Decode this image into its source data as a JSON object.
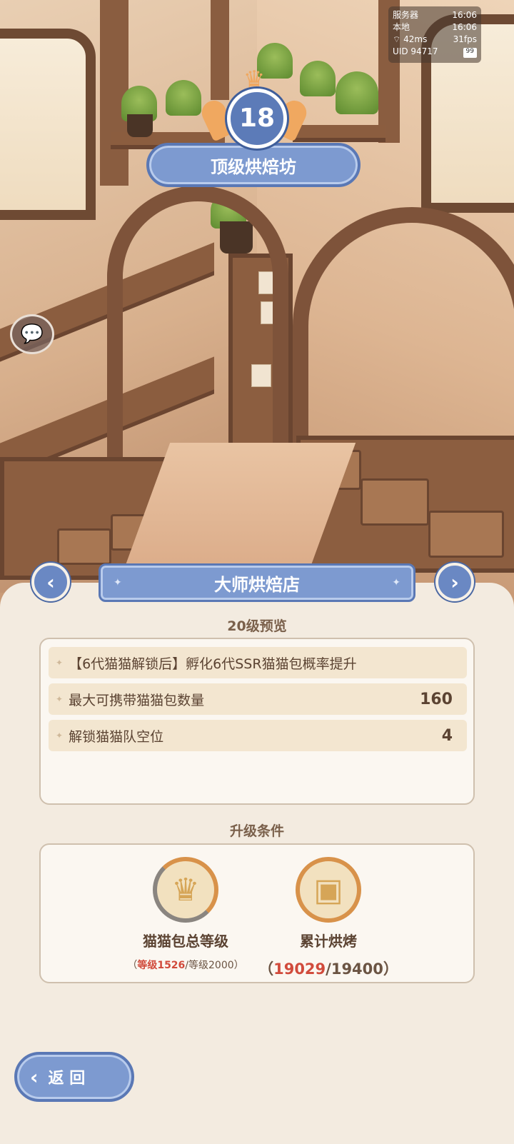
{
  "hud": {
    "server_label": "服务器",
    "server_time": "16:06",
    "local_label": "本地",
    "local_time": "16:06",
    "ping": "42ms",
    "fps": "31fps",
    "uid": "UID 94717",
    "battery": "99"
  },
  "badge": {
    "level": "18",
    "title": "顶级烘焙坊"
  },
  "panel": {
    "title": "大师烘焙店",
    "preview_title": "20级预览",
    "perks": [
      {
        "text": "【6代猫猫解锁后】孵化6代SSR猫猫包概率提升",
        "value": ""
      },
      {
        "text": "最大可携带猫猫包数量",
        "value": "160"
      },
      {
        "text": "解锁猫猫队空位",
        "value": "4"
      }
    ],
    "conditions_title": "升级条件",
    "conditions": [
      {
        "name": "猫猫包总等级",
        "icon": "crown-cat-icon",
        "progress_open": "（",
        "current": "等级1526",
        "separator": "/",
        "target": "等级2000",
        "progress_close": "）"
      },
      {
        "name": "累计烘烤",
        "icon": "oven-icon",
        "progress_open": "（",
        "current": "19029",
        "separator": "/",
        "target": "19400",
        "progress_close": "）"
      }
    ]
  },
  "back_button": {
    "label": "返 回"
  },
  "colors": {
    "accent_blue": "#7d9ad0",
    "panel_bg": "#f3ebe0",
    "progress_red": "#d14b3c",
    "ring_orange": "#d8924a"
  }
}
